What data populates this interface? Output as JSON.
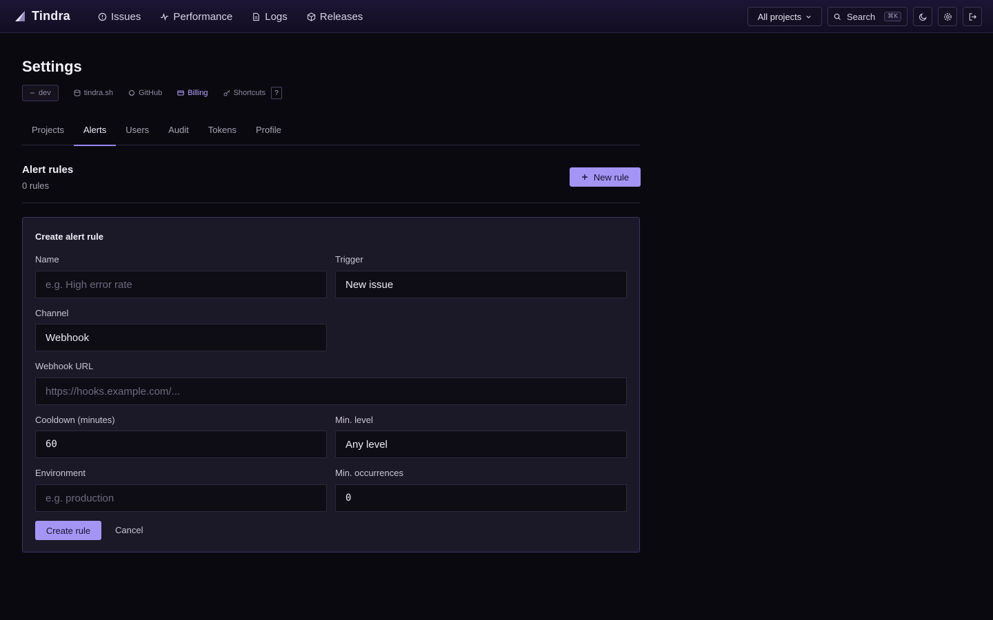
{
  "app": {
    "name": "Tindra"
  },
  "nav": {
    "items": [
      {
        "label": "Issues",
        "icon": "alert-circle-icon"
      },
      {
        "label": "Performance",
        "icon": "activity-icon"
      },
      {
        "label": "Logs",
        "icon": "file-icon"
      },
      {
        "label": "Releases",
        "icon": "package-icon"
      }
    ]
  },
  "topbar": {
    "project_select": "All projects",
    "search_label": "Search",
    "search_shortcut": "⌘K"
  },
  "page": {
    "title": "Settings",
    "env_badge": "dev",
    "links": [
      {
        "label": "tindra.sh",
        "icon": "database-icon"
      },
      {
        "label": "GitHub",
        "icon": "github-icon"
      },
      {
        "label": "Billing",
        "icon": "credit-card-icon",
        "active": true
      },
      {
        "label": "Shortcuts",
        "icon": "key-icon"
      }
    ],
    "shortcut_badge": "?"
  },
  "tabs": [
    "Projects",
    "Alerts",
    "Users",
    "Audit",
    "Tokens",
    "Profile"
  ],
  "active_tab": "Alerts",
  "alerts": {
    "title": "Alert rules",
    "count": "0 rules",
    "new_rule": "New rule"
  },
  "form": {
    "title": "Create alert rule",
    "name_label": "Name",
    "name_placeholder": "e.g. High error rate",
    "trigger_label": "Trigger",
    "trigger_value": "New issue",
    "channel_label": "Channel",
    "channel_value": "Webhook",
    "webhook_label": "Webhook URL",
    "webhook_placeholder": "https://hooks.example.com/...",
    "cooldown_label": "Cooldown (minutes)",
    "cooldown_value": "60",
    "level_label": "Min. level",
    "level_value": "Any level",
    "env_label": "Environment",
    "env_placeholder": "e.g. production",
    "occ_label": "Min. occurrences",
    "occ_value": "0",
    "submit": "Create rule",
    "cancel": "Cancel"
  },
  "colors": {
    "accent": "#a495f5",
    "active_link": "#b7a4ff",
    "background": "#0b0910",
    "card": "#1b1828"
  }
}
